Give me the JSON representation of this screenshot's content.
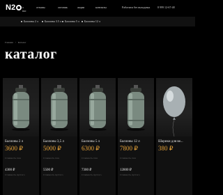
{
  "header": {
    "logo": "N2",
    "nav": [
      "о нас",
      "отзывы",
      "оптовик",
      "акции",
      "контакты"
    ],
    "hours": "Работаем без выходных",
    "phone": "8 999 12-67-48"
  },
  "subnav": {
    "items": [
      "Баллоны 2 л",
      "Баллоны 3.5 л",
      "Баллоны 5 л",
      "Баллоны 12 л"
    ]
  },
  "breadcrumb": {
    "home": "Главная",
    "sep": "/",
    "current": "Каталог"
  },
  "page": {
    "title": "каталог"
  },
  "products": [
    {
      "name": "Баллоны 2 л",
      "price": "3600 ₽",
      "label": "Стоимость газа",
      "price2": "4300 ₽",
      "label2": "Стоимость пустого",
      "icon": "gas-cylinder-icon"
    },
    {
      "name": "Баллоны 3,5 л",
      "price": "5000 ₽",
      "label": "Стоимость газа",
      "price2": "5500 ₽",
      "label2": "Стоимость пустого",
      "icon": "gas-cylinder-icon"
    },
    {
      "name": "Баллоны 5 л",
      "price": "6300 ₽",
      "label": "Стоимость газа",
      "price2": "7300 ₽",
      "label2": "Стоимость пустого",
      "icon": "gas-cylinder-icon"
    },
    {
      "name": "Баллоны 12 л",
      "price": "7800 ₽",
      "label": "Стоимость газа",
      "price2": "12800 ₽",
      "label2": "Стоимость пустого",
      "icon": "gas-cylinder-icon"
    },
    {
      "name": "Шарики для ве...",
      "price": "380 ₽",
      "label": "",
      "price2": "",
      "label2": "",
      "icon": "balloon-icon"
    }
  ],
  "colors": {
    "background": "#000000",
    "price": "#e8a43a",
    "card": "#111111"
  }
}
